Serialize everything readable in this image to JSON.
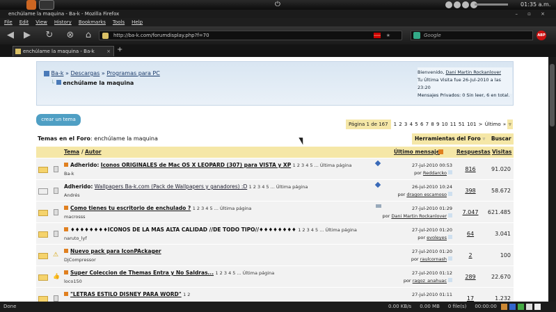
{
  "os": {
    "clock": "01:35 a.m."
  },
  "window": {
    "title": "enchúlame la maquina - Ba-k - Mozilla Firefox"
  },
  "menu": [
    "File",
    "Edit",
    "View",
    "History",
    "Bookmarks",
    "Tools",
    "Help"
  ],
  "nav": {
    "url": "http://ba-k.com/forumdisplay.php?f=70",
    "search_placeholder": "Google"
  },
  "tab": {
    "label": "enchúlame la maquina - Ba-k"
  },
  "breadcrumb": {
    "site": "Ba-k",
    "sep": "»",
    "c1": "Descargas",
    "c2": "Programas para PC",
    "current": "enchúlame la maquina"
  },
  "welcome": {
    "greeting": "Bienvenido,",
    "user": "Dani Martin Rockanlover",
    "last_visit": "Tu Última Visita fue 26-Jul-2010 a las 23:20",
    "pm": "Mensajes Privados: 0 Sin leer, 6 en total."
  },
  "new_thread": "crear un tema",
  "pager": {
    "label": "Página 1 de 167",
    "nums": "1 2 3 4 5 6 7 8 9 10 11 51 101 > Último »"
  },
  "forum": {
    "prefix": "Temas en el Foro",
    "name": ": enchúlame la maquina"
  },
  "tools": {
    "herramientas": "Herramientas del Foro",
    "buscar": "Buscar"
  },
  "thead": {
    "tema": "Tema",
    "slash": "/",
    "autor": "Autor",
    "ultimo": "Último mensaje",
    "respuestas": "Respuestas",
    "visitas": "Visitas"
  },
  "threads": [
    {
      "prefix": "Adherido:",
      "title": "Iconos ORIGINALES de Mac OS X LEOPARD (307) para VISTA y XP",
      "pages": "1 2 3 4 5 ... Última página",
      "author": "Ba-k",
      "date": "27-jul-2010 00:53",
      "by": "por",
      "last_user": "Reddarcko",
      "replies": "816",
      "views": "91.020"
    },
    {
      "prefix": "Adherido:",
      "title": "Wallpapers Ba-k.com (Pack de Wallpapers y ganadores) :D",
      "pages": "1 2 3 4 5 ... Última página",
      "author": "Andrés",
      "date": "26-jul-2010 10:24",
      "by": "por",
      "last_user": "dragon escamoso",
      "replies": "398",
      "views": "58.672"
    },
    {
      "prefix": "",
      "title": "Como tienes tu escritorio de enchulado ?",
      "pages": "1 2 3 4 5 ... Última página",
      "author": "macrosss",
      "date": "27-jul-2010 01:29",
      "by": "por",
      "last_user": "Dani Martin Rockanlover",
      "replies": "7.047",
      "views": "621.485"
    },
    {
      "prefix": "",
      "title": "♦♦♦♦♦♦♦♦ICONOS DE LA MAS ALTA CALIDAD //DE TODO TIPO//♦♦♦♦♦♦♦♦",
      "pages": "1 2 3 4 5 ... Última página",
      "author": "naruto_lyf",
      "date": "27-jul-2010 01:20",
      "by": "por",
      "last_user": "evoleyes",
      "replies": "64",
      "views": "3.041"
    },
    {
      "prefix": "",
      "title": "Nuevo pack para IconPAckager",
      "pages": "",
      "author": "DjCompressor",
      "date": "27-jul-2010 01:20",
      "by": "por",
      "last_user": "raulcornash",
      "replies": "2",
      "views": "100"
    },
    {
      "prefix": "",
      "title": "Super Coleccion de Themas Entra y No Saldras...",
      "pages": "1 2 3 4 5 ... Última página",
      "author": "loco150",
      "date": "27-jul-2010 01:12",
      "by": "por",
      "last_user": "ragoz_anahuac",
      "replies": "289",
      "views": "22.670"
    },
    {
      "prefix": "",
      "title": "\"LETRAS ESTILO DISNEY PARA WORD\"",
      "pages": "1 2",
      "author": "",
      "date": "27-jul-2010 01:11",
      "by": "",
      "last_user": "",
      "replies": "17",
      "views": "1.232"
    }
  ],
  "status": {
    "left": "Done",
    "speed": "0.00 KB/s",
    "mem": "0.00 MB",
    "files": "0 file(s)",
    "time": "00:00:00"
  }
}
